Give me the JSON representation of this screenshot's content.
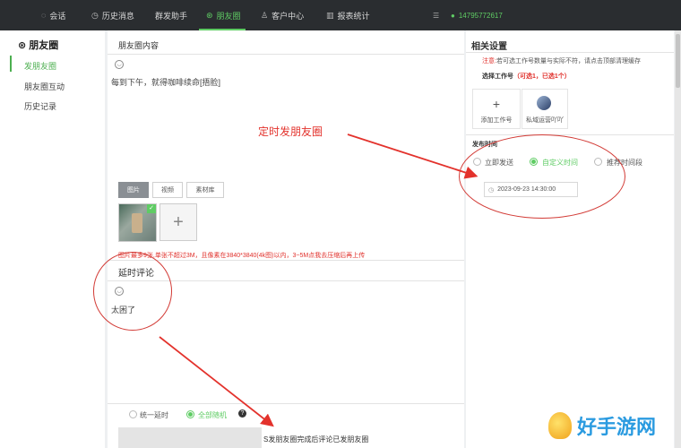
{
  "nav": {
    "items": [
      {
        "label": "会话",
        "icon": "chat-icon"
      },
      {
        "label": "历史消息",
        "icon": "clock-icon"
      },
      {
        "label": "群发助手",
        "icon": ""
      },
      {
        "label": "朋友圈",
        "icon": "moments-icon"
      },
      {
        "label": "客户中心",
        "icon": "user-icon"
      },
      {
        "label": "报表统计",
        "icon": "chart-icon"
      }
    ],
    "phone": "14795772617",
    "accent": "#5fcc64"
  },
  "sidebar": {
    "title": "朋友圈",
    "items": [
      "发朋友圈",
      "朋友圈互动",
      "历史记录"
    ]
  },
  "main": {
    "section_title": "朋友圈内容",
    "post_text": "每到下午，就得咖啡续命[捂脸]",
    "media_tabs": [
      "图片",
      "视频",
      "素材库"
    ],
    "image_hint": "图片最多9张,单张不超过3M，且像素在3840*3840(4k图)以内，3~5M点我去压缩后再上传",
    "comment_title": "延时评论",
    "comment_text": "太困了",
    "radio_options": [
      "统一延时",
      "全部随机"
    ],
    "footer_hint": "S发朋友圈完成后评论已发朋友圈"
  },
  "right": {
    "title": "相关设置",
    "notice_prefix": "注意:",
    "notice_text": "若可选工作号数量与实际不符，请点击顶部清理缓存",
    "select_label": "选择工作号",
    "select_count": "（可选1，已选1个）",
    "add_label": "添加工作号",
    "account_name": "私域运营吖吖",
    "publish_time_label": "发布时间",
    "time_options": [
      "立即发送",
      "自定义时间",
      "推荐时间段"
    ],
    "datetime": "2023-09-23 14:30:00"
  },
  "annotation": {
    "label": "定时发朋友圈"
  },
  "watermark": {
    "text": "好手游网"
  }
}
